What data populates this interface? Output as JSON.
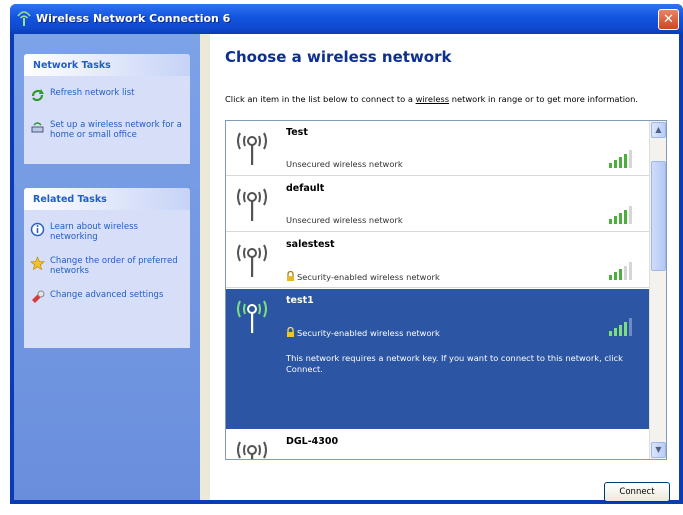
{
  "window": {
    "title": "Wireless Network Connection 6",
    "close_glyph": "✕"
  },
  "sidebar": {
    "network_tasks": {
      "header": "Network Tasks",
      "items": [
        {
          "label": "Refresh network list",
          "icon": "refresh-icon"
        },
        {
          "label": "Set up a wireless network for a home or small office",
          "icon": "setup-network-icon"
        }
      ]
    },
    "related_tasks": {
      "header": "Related Tasks",
      "items": [
        {
          "label": "Learn about wireless networking",
          "icon": "info-icon"
        },
        {
          "label": "Change the order of preferred networks",
          "icon": "star-icon"
        },
        {
          "label": "Change advanced settings",
          "icon": "settings-icon"
        }
      ]
    }
  },
  "main": {
    "title": "Choose a wireless network",
    "description_prefix": "Click an item in the list below to connect to a ",
    "description_link": "wireless",
    "description_suffix": " network in range or to get more information.",
    "networks": [
      {
        "name": "Test",
        "status": "Unsecured wireless network",
        "secured": false,
        "signal_bars": 4,
        "selected": false
      },
      {
        "name": "default",
        "status": "Unsecured wireless network",
        "secured": false,
        "signal_bars": 4,
        "selected": false
      },
      {
        "name": "salestest",
        "status": "Security-enabled wireless network",
        "secured": true,
        "signal_bars": 3,
        "selected": false
      },
      {
        "name": "test1",
        "status": "Security-enabled wireless network",
        "secured": true,
        "signal_bars": 4,
        "selected": true,
        "message": "This network requires a network key. If you want to connect to this network, click Connect."
      },
      {
        "name": "DGL-4300",
        "status": "",
        "secured": false,
        "signal_bars": 0,
        "selected": false
      }
    ],
    "connect_button": "Connect"
  },
  "colors": {
    "title_bar": "#1354de",
    "task_pane": "#6a8edc",
    "selected_row": "#2c55a3",
    "heading": "#0c2f90",
    "link": "#215dc6"
  }
}
